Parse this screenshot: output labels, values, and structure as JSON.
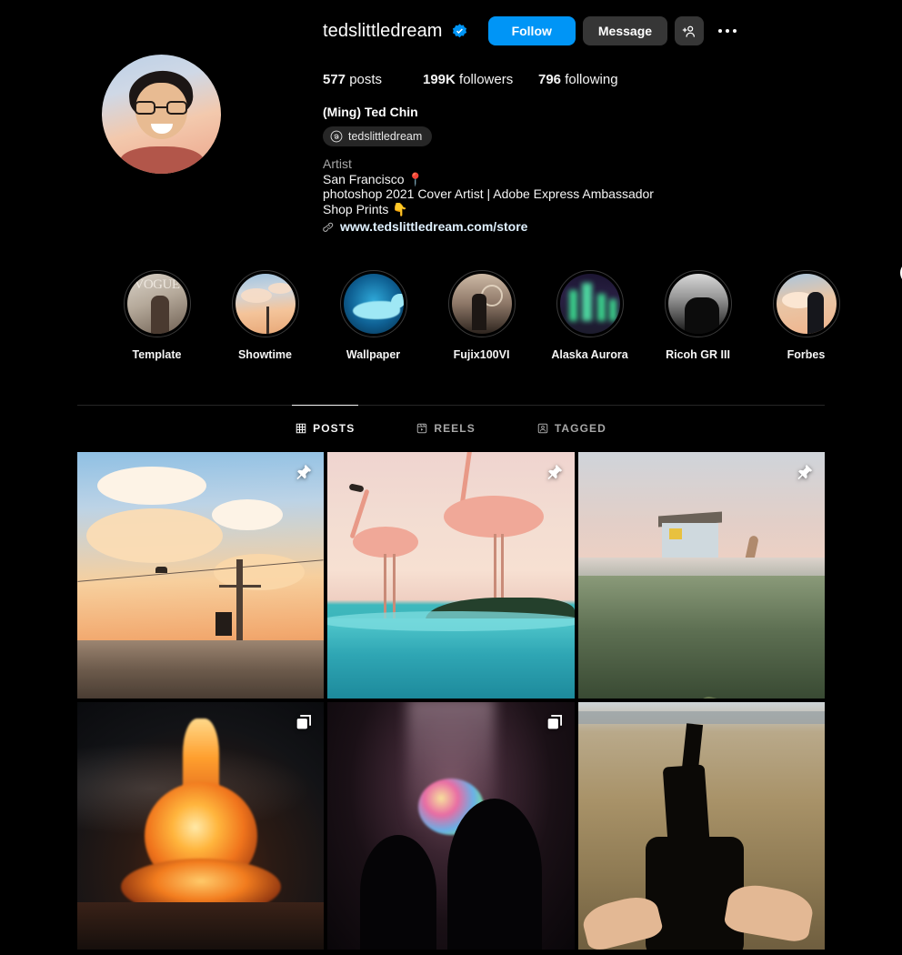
{
  "profile": {
    "username": "tedslittledream",
    "verified_icon": "verified-badge-icon",
    "full_name": "(Ming) Ted Chin",
    "avatar_alt": "profile-photo",
    "threads_handle": "tedslittledream",
    "threads_icon": "threads-icon",
    "category": "Artist",
    "bio_lines": [
      "San Francisco 📍",
      "photoshop 2021 Cover Artist | Adobe Express Ambassador",
      "Shop Prints 👇"
    ],
    "link_icon": "link-icon",
    "link_text": "www.tedslittledream.com/store"
  },
  "actions": {
    "follow_label": "Follow",
    "message_label": "Message",
    "add_person_icon": "add-person-icon",
    "more_options_icon": "more-options-icon",
    "accent_color": "#0095f6",
    "secondary_button_color": "#363636"
  },
  "stats": [
    {
      "value": "577",
      "label": "posts"
    },
    {
      "value": "199K",
      "label": "followers"
    },
    {
      "value": "796",
      "label": "following"
    }
  ],
  "highlights": {
    "next_icon": "chevron-right-icon",
    "items": [
      {
        "label": "Template",
        "art": "art-vogue"
      },
      {
        "label": "Showtime",
        "art": "art-sunset"
      },
      {
        "label": "Wallpaper",
        "art": "art-whale"
      },
      {
        "label": "Fujix100VI",
        "art": "art-fuji"
      },
      {
        "label": "Alaska Aurora",
        "art": "art-aurora"
      },
      {
        "label": "Ricoh GR III",
        "art": "art-ricoh"
      },
      {
        "label": "Forbes",
        "art": "art-forbes"
      }
    ]
  },
  "tabs": [
    {
      "label": "POSTS",
      "icon": "grid-icon",
      "active": true
    },
    {
      "label": "REELS",
      "icon": "reels-icon",
      "active": false
    },
    {
      "label": "TAGGED",
      "icon": "tagged-icon",
      "active": false
    }
  ],
  "posts": [
    {
      "art": "p1",
      "badge": "pin-icon",
      "alt": "fish-clouds-sunset-utility-pole"
    },
    {
      "art": "p2",
      "badge": "pin-icon",
      "alt": "flamingo-clouds-over-ocean"
    },
    {
      "art": "p3",
      "badge": "pin-icon",
      "alt": "floating-house-with-octopus"
    },
    {
      "art": "p4",
      "badge": "carousel-icon",
      "alt": "fire-explosion-at-night"
    },
    {
      "art": "p5",
      "badge": "carousel-icon",
      "alt": "silhouettes-watching-glowing-orb"
    },
    {
      "art": "p6",
      "badge": null,
      "alt": "hands-gripping-chasm-in-tundra"
    }
  ]
}
